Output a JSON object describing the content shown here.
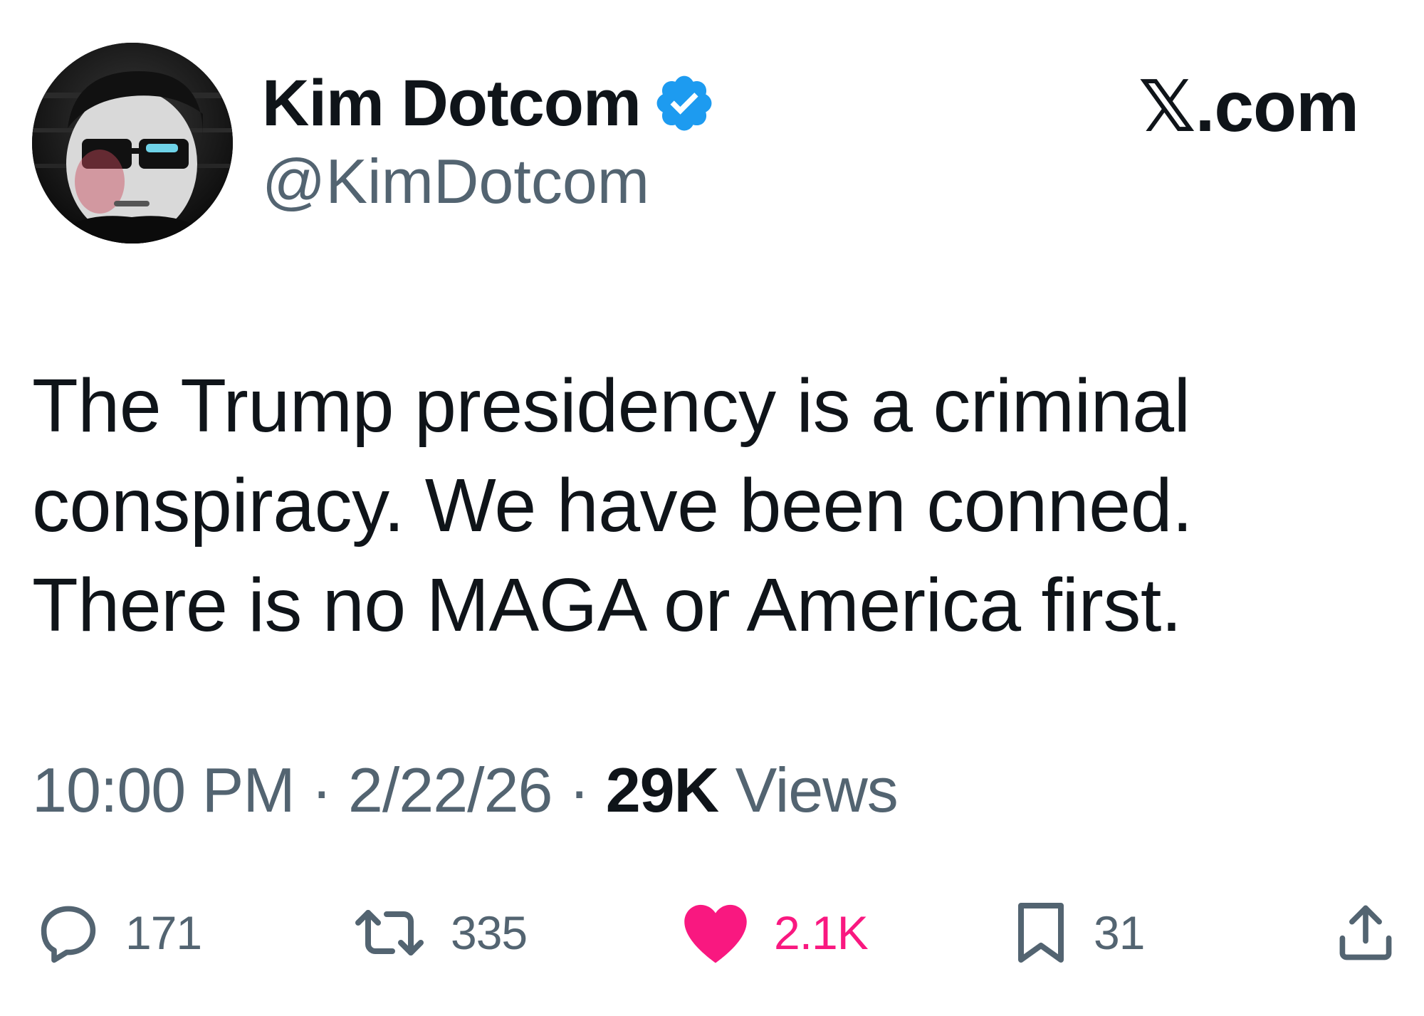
{
  "author": {
    "display_name": "Kim Dotcom",
    "handle": "@KimDotcom",
    "verified": true,
    "avatar_icon": "avatar-photo"
  },
  "brand": "𝕏.com",
  "tweet": {
    "text": "The Trump presidency is a criminal\nconspiracy. We have been conned.\nThere is no MAGA or America first.",
    "time": "10:00 PM",
    "date": "2/22/26",
    "separator": "·",
    "views_count": "29K",
    "views_label": "Views"
  },
  "actions": {
    "replies": "171",
    "reposts": "335",
    "likes": "2.1K",
    "bookmarks": "31"
  },
  "icons": {
    "reply": "reply-icon",
    "repost": "repost-icon",
    "like": "heart-icon",
    "bookmark": "bookmark-icon",
    "share": "share-icon",
    "verified": "verified-badge-icon"
  },
  "colors": {
    "text": "#0f1419",
    "secondary": "#536471",
    "verified": "#1d9bf0",
    "like": "#f91880"
  }
}
